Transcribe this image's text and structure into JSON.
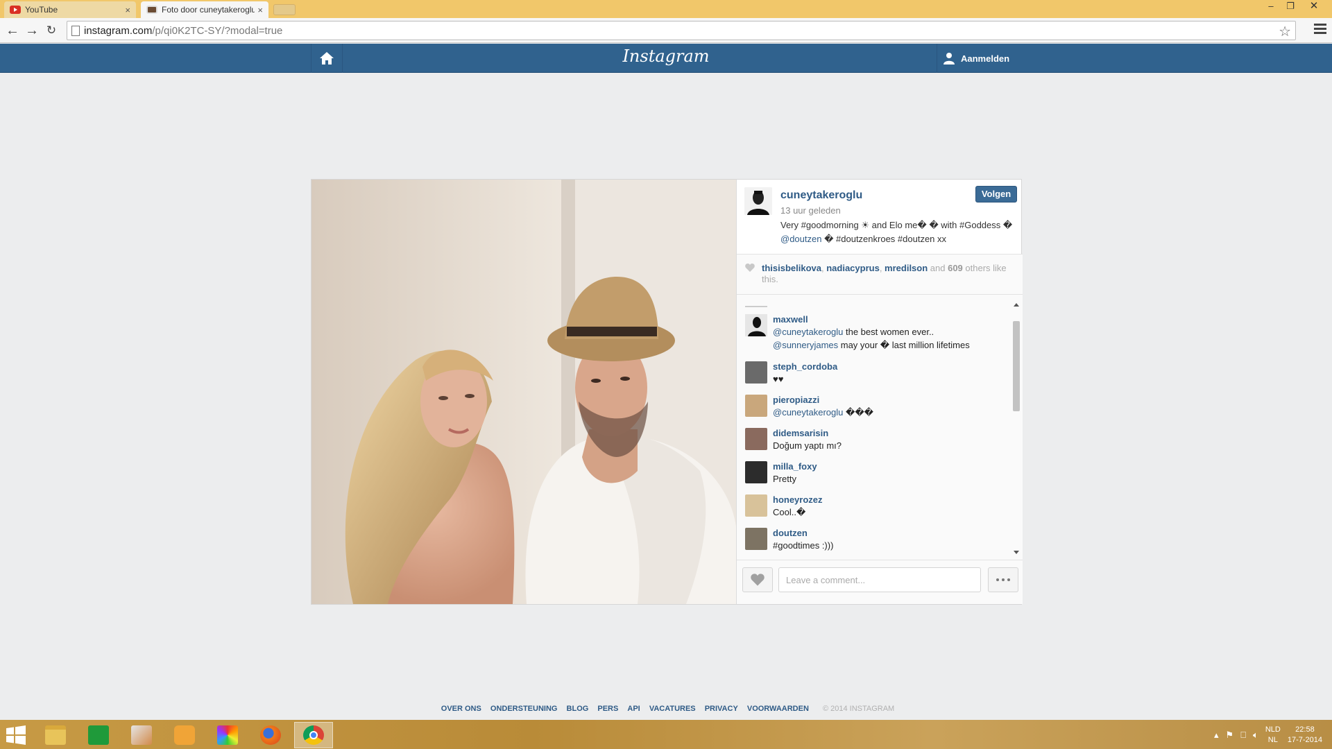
{
  "browser": {
    "tabs": [
      {
        "label": "YouTube",
        "close": "×"
      },
      {
        "label": "Foto door cuneytakeroglu",
        "close": "×"
      }
    ],
    "url_host": "instagram.com",
    "url_path": "/p/qi0K2TC-SY/?modal=true"
  },
  "header": {
    "logo": "Instagram",
    "login_label": "Aanmelden"
  },
  "post": {
    "username": "cuneytakeroglu",
    "time_ago": "13 uur geleden",
    "follow_label": "Volgen",
    "caption_part1": "Very #goodmorning ☀ and Elo me� � with #Goddess �",
    "caption_mention": "@doutzen",
    "caption_part2": " � #doutzenkroes #doutzen xx"
  },
  "likes": {
    "liker1": "thisisbelikova",
    "sep1": ", ",
    "liker2": "nadiacyprus",
    "sep2": ", ",
    "liker3": "mredilson",
    "and_text": " and ",
    "count": "609",
    "suffix": " others like this."
  },
  "comments": [
    {
      "user": "maxwell",
      "mention": "@cuneytakeroglu",
      "text": " the best women ever..",
      "mention2": "@sunneryjames",
      "text2": " may your � last million lifetimes"
    },
    {
      "user": "steph_cordoba",
      "text": "♥♥"
    },
    {
      "user": "pieropiazzi",
      "mention": "@cuneytakeroglu",
      "text": " ���"
    },
    {
      "user": "didemsarisin",
      "text": "Doğum yaptı mı?"
    },
    {
      "user": "milla_foxy",
      "text": "Pretty"
    },
    {
      "user": "honeyrozez",
      "text": "Cool..�"
    },
    {
      "user": "doutzen",
      "text": "#goodtimes :)))"
    }
  ],
  "comment_box": {
    "placeholder": "Leave a comment..."
  },
  "footer": {
    "links": [
      "OVER ONS",
      "ONDERSTEUNING",
      "BLOG",
      "PERS",
      "API",
      "VACATURES",
      "PRIVACY",
      "VOORWAARDEN"
    ],
    "copyright": "© 2014 INSTAGRAM"
  },
  "taskbar": {
    "lang_line1": "NLD",
    "lang_line2": "NL",
    "time": "22:58",
    "date": "17-7-2014"
  },
  "icons": {
    "home": "home-icon",
    "user": "user-icon",
    "heart": "heart-icon",
    "more": "more-icon",
    "star": "star-icon"
  },
  "colors": {
    "header_blue": "#30628e",
    "link_blue": "#2f5b86",
    "tab_strip": "#f1c76a",
    "page_bg": "#ecedee"
  }
}
